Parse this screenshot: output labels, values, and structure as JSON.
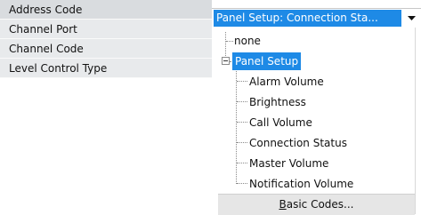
{
  "properties": [
    {
      "label": "Address Code"
    },
    {
      "label": "Channel Port"
    },
    {
      "label": "Channel Code"
    },
    {
      "label": "Level Control Type"
    }
  ],
  "combo": {
    "value": "Panel Setup: Connection Sta...",
    "arrow_icon": "dropdown-arrow-icon"
  },
  "tree": {
    "none_label": "none",
    "parent_label": "Panel Setup",
    "expander_icon": "collapse-minus-icon",
    "children": [
      {
        "label": "Alarm Volume"
      },
      {
        "label": "Brightness"
      },
      {
        "label": "Call Volume"
      },
      {
        "label": "Connection Status"
      },
      {
        "label": "Master Volume"
      },
      {
        "label": "Notification Volume"
      }
    ]
  },
  "footer": {
    "accel": "B",
    "rest": "asic Codes..."
  },
  "colors": {
    "selection": "#1e8ae6",
    "property_bg": "#e8eaec",
    "footer_bg": "#e6e6e6"
  }
}
